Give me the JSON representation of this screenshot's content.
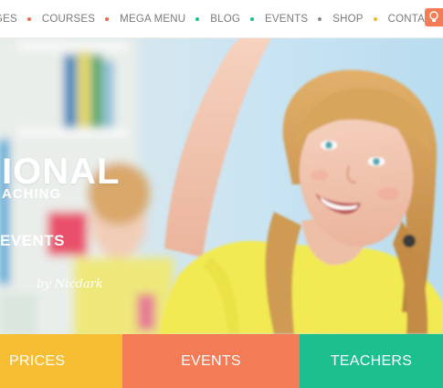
{
  "nav": {
    "items": [
      {
        "label": "GES",
        "dot": "#f0674c"
      },
      {
        "label": "COURSES",
        "dot": "#f0674c"
      },
      {
        "label": "MEGA MENU",
        "dot": "#1bbf91"
      },
      {
        "label": "BLOG",
        "dot": "#1bbf91"
      },
      {
        "label": "EVENTS",
        "dot": "#8a8a8a"
      },
      {
        "label": "SHOP",
        "dot": "#f3b52a"
      },
      {
        "label": "CONTACTS",
        "dot": null
      }
    ],
    "button_icon": "lightbulb-icon"
  },
  "hero": {
    "title": "IONAL",
    "subtitle": "ACHING",
    "link": "EVENTS",
    "signature": "by Nicdark"
  },
  "features": [
    {
      "label": "PRICES",
      "color": "#f7bd33",
      "width_label": "prices"
    },
    {
      "label": "EVENTS",
      "color": "#f37b55",
      "width_label": "events"
    },
    {
      "label": "TEACHERS",
      "color": "#1dbf8f",
      "width_label": "teachers"
    }
  ],
  "colors": {
    "accent_orange": "#f57c54",
    "accent_yellow": "#f7bd33",
    "accent_green": "#1dbf8f"
  }
}
